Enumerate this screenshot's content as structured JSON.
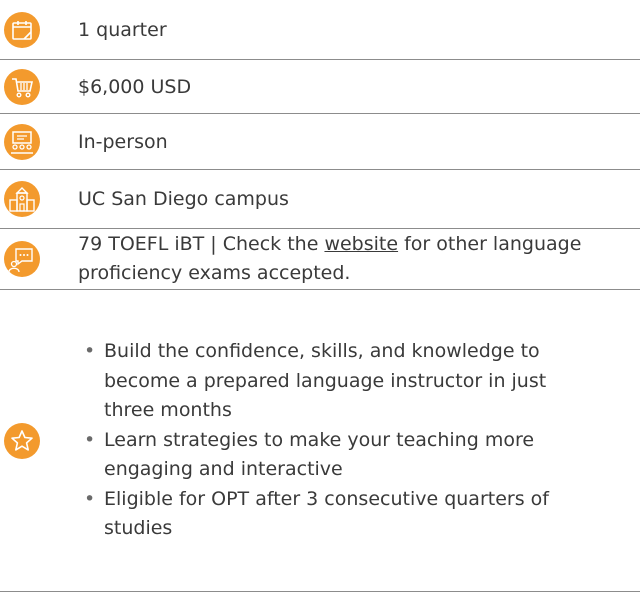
{
  "accent_color": "#f39a2d",
  "rows": [
    {
      "icon": "calendar-icon",
      "text": "1 quarter"
    },
    {
      "icon": "shopping-cart-icon",
      "text": "$6,000 USD"
    },
    {
      "icon": "classroom-icon",
      "text": "In-person"
    },
    {
      "icon": "campus-building-icon",
      "text": "UC San Diego campus"
    },
    {
      "icon": "chat-user-icon",
      "text_before": "79 TOEFL iBT  |  Check the ",
      "link": "website",
      "text_after": " for other language proficiency exams accepted."
    }
  ],
  "highlights": {
    "icon": "star-icon",
    "items": [
      "Build the confidence, skills, and knowledge to become a prepared language instructor in just three months",
      "Learn strategies to make your teaching more engaging and interactive",
      "Eligible for OPT after 3 consecutive quarters of studies"
    ]
  }
}
